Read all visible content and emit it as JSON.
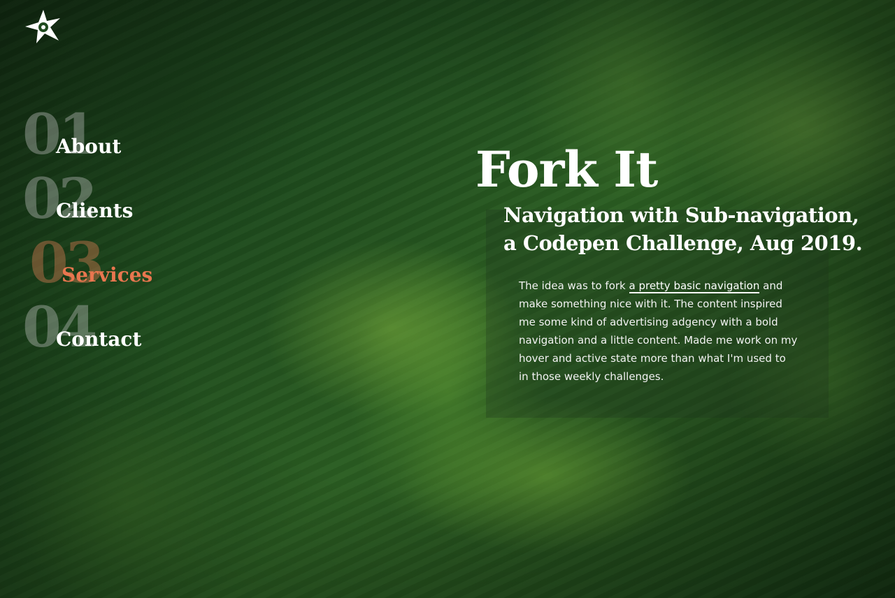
{
  "logo": {
    "icon": "star-logo-icon",
    "color": "#ffffff"
  },
  "nav": {
    "items": [
      {
        "number": "01",
        "label": "About",
        "active": false
      },
      {
        "number": "02",
        "label": "Clients",
        "active": false
      },
      {
        "number": "03",
        "label": "Services",
        "active": true
      },
      {
        "number": "04",
        "label": "Contact",
        "active": false
      }
    ],
    "active_color": "#e8764f"
  },
  "hero": {
    "title": "Fork It",
    "subtitle": "Navigation with Sub-navigation, a Codepen Challenge, Aug 2019.",
    "body_before_link": "The idea was to fork ",
    "link_text": "a pretty basic navigation",
    "body_after_link": " and make something nice with it. The content inspired me some kind of advertising adgency with a bold navigation and a little content. Made me work on my hover and active state more than what I'm used to in those weekly challenges."
  }
}
